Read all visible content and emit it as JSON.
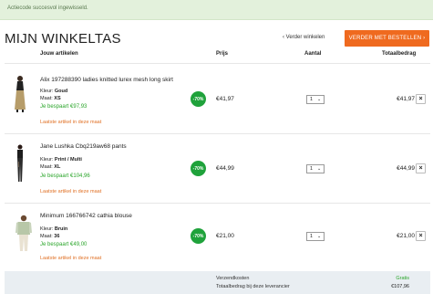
{
  "alert": {
    "message": "Actiecode succesvol ingewisseld."
  },
  "header": {
    "title": "MIJN WINKELTAS",
    "continue_label": "‹ Verder winkelen",
    "order_button": "VERDER MET BESTELLEN ›"
  },
  "columns": {
    "items": "Jouw artikelen",
    "price": "Prijs",
    "quantity": "Aantal",
    "total": "Totaalbedrag"
  },
  "items": [
    {
      "title": "Alix 197288390 ladies knitted lurex mesh long skirt",
      "color_label": "Kleur:",
      "color": "Goud",
      "size_label": "Maat:",
      "size": "XS",
      "saved": "Je bespaart €97,93",
      "last": "Laatste artikel in deze maat",
      "discount": "-70%",
      "price": "€41,97",
      "quantity": "1",
      "total": "€41,97"
    },
    {
      "title": "Jane Lushka Cbq219aw68 pants",
      "color_label": "Kleur:",
      "color": "Print / Multi",
      "size_label": "Maat:",
      "size": "XL",
      "saved": "Je bespaart €104,96",
      "last": "Laatste artikel in deze maat",
      "discount": "-70%",
      "price": "€44,99",
      "quantity": "1",
      "total": "€44,99"
    },
    {
      "title": "Minimum 166766742 cathia blouse",
      "color_label": "Kleur:",
      "color": "Bruin",
      "size_label": "Maat:",
      "size": "36",
      "saved": "Je bespaart €49,00",
      "last": "Laatste artikel in deze maat",
      "discount": "-70%",
      "price": "€21,00",
      "quantity": "1",
      "total": "€21,00"
    }
  ],
  "icons": {
    "remove": "close-icon",
    "dropdown": "chevron-down-icon"
  },
  "footer": {
    "shipping_label": "Verzendkosten",
    "shipping_value": "Gratis",
    "total_label": "Totaalbedrag bij deze leverancier",
    "total_value": "€107,96"
  },
  "colors": {
    "accent": "#ef6a1f",
    "discount": "#1fa23b",
    "saved": "#2aa52a",
    "warning": "#e07024",
    "alert_bg": "#e3f1dc"
  }
}
